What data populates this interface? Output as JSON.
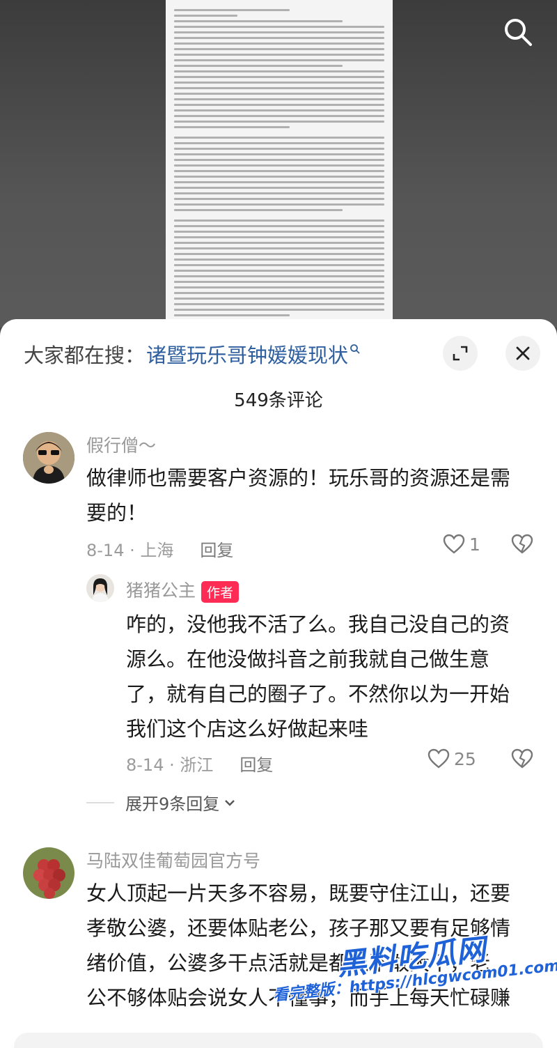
{
  "search_hint": {
    "prefix": "大家都在搜：",
    "query": "诸暨玩乐哥钟媛媛现状"
  },
  "comment_count": "549条评论",
  "comments": [
    {
      "user": "假行僧～",
      "text_lines": [
        "做律师也需要客户资源的！玩乐哥的资源还是需",
        "要的！"
      ],
      "date_location": "8-14 · 上海",
      "reply_label": "回复",
      "likes": "1"
    },
    {
      "user": "猪猪公主",
      "badge": "作者",
      "text_lines": [
        "咋的，没他我不活了么。我自己没自己的资",
        "源么。在他没做抖音之前我就自己做生意",
        "了，就有自己的圈子了。不然你以为一开始",
        "我们这个店这么好做起来哇"
      ],
      "date_location": "8-14 · 浙江",
      "reply_label": "回复",
      "likes": "25"
    },
    {
      "user": "马陆双佳葡萄园官方号",
      "text_lines": [
        "女人顶起一片天多不容易，既要守住江山，还要",
        "孝敬公婆，还要体贴老公，孩子那又要有足够情",
        "绪价值，公婆多干点活就是都说不敢大干，老",
        "公不够体贴会说女人不懂事，而手上每天忙碌赚"
      ]
    }
  ],
  "expand_replies": "展开9条回复",
  "watermark": {
    "logo": "黑料吃瓜网",
    "url": "看完整版：https://hlcgwcom01.com"
  },
  "icons": {
    "search": "search-icon",
    "expand": "expand-icon",
    "close": "close-icon",
    "heart": "heart-icon",
    "dislike": "broken-heart-icon"
  },
  "colors": {
    "accent_red": "#fe2c55",
    "link_blue": "#2f5f9e"
  }
}
